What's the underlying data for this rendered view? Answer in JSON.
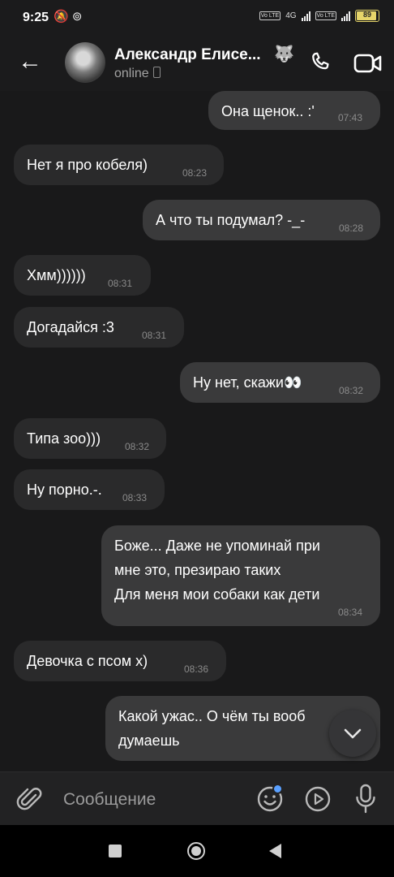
{
  "status_bar": {
    "time": "9:25",
    "battery": "89",
    "network": "4G"
  },
  "header": {
    "back": "←",
    "name": "Александр Елисе...",
    "name_emoji": "🐺",
    "status": "online"
  },
  "messages": [
    {
      "dir": "out",
      "text": "Она щенок.. :'",
      "time": "07:43"
    },
    {
      "dir": "in",
      "text": "Нет я про кобеля)",
      "time": "08:23"
    },
    {
      "dir": "out",
      "text": "А что ты подумал? -_-",
      "time": "08:28"
    },
    {
      "dir": "in",
      "text": "Хмм))))))",
      "time": "08:31"
    },
    {
      "dir": "in",
      "text": "Догадайся :3",
      "time": "08:31"
    },
    {
      "dir": "out",
      "text": "Ну нет, скажи👀",
      "time": "08:32"
    },
    {
      "dir": "in",
      "text": "Типа зоо)))",
      "time": "08:32"
    },
    {
      "dir": "in",
      "text": "Ну порно.-.",
      "time": "08:33"
    },
    {
      "dir": "out",
      "text": "Боже... Даже не упоминай при\nмне это, презираю таких\nДля меня мои собаки как дети",
      "time": "08:34"
    },
    {
      "dir": "in",
      "text": "Девочка с псом х)",
      "time": "08:36"
    },
    {
      "dir": "out",
      "text": "Какой ужас.. О чём ты вооб\nдумаешь",
      "time": ""
    }
  ],
  "composer": {
    "placeholder": "Сообщение"
  },
  "icons": {
    "back": "arrow-left-icon",
    "call": "phone-icon",
    "video": "video-camera-icon",
    "attach": "paperclip-icon",
    "emoji": "smiley-icon",
    "play": "play-circle-icon",
    "mic": "microphone-icon",
    "scroll": "chevron-down-icon"
  },
  "colors": {
    "background": "#19191a",
    "bubble_in": "#2a2a2b",
    "bubble_out": "#3a3a3b",
    "badge": "#5aa0ff",
    "battery": "#e6d56a"
  }
}
